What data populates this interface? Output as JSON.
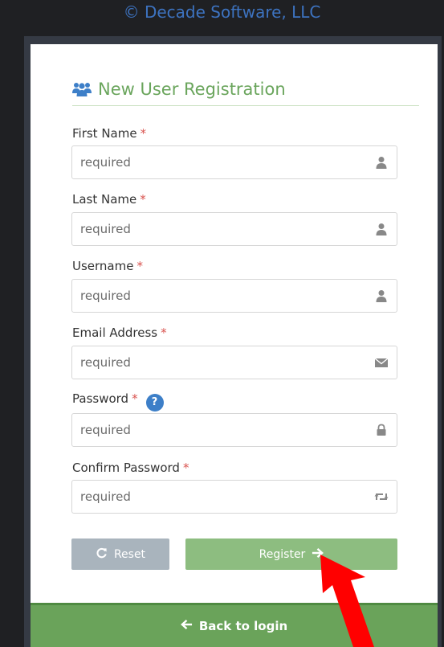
{
  "header": {
    "copyright": "© Decade Software, LLC"
  },
  "form": {
    "title": "New User Registration",
    "title_icon": "users-icon",
    "required_marker": "*",
    "fields": [
      {
        "label": "First Name",
        "placeholder": "required",
        "icon": "user-icon"
      },
      {
        "label": "Last Name",
        "placeholder": "required",
        "icon": "user-icon"
      },
      {
        "label": "Username",
        "placeholder": "required",
        "icon": "user-icon"
      },
      {
        "label": "Email Address",
        "placeholder": "required",
        "icon": "envelope-icon"
      },
      {
        "label": "Password",
        "placeholder": "required",
        "icon": "lock-icon",
        "help": "?"
      },
      {
        "label": "Confirm Password",
        "placeholder": "required",
        "icon": "retweet-icon"
      }
    ]
  },
  "actions": {
    "reset_label": "Reset",
    "reset_icon": "refresh-icon",
    "register_label": "Register",
    "register_icon": "arrow-right-icon"
  },
  "footer": {
    "back_label": "Back to login",
    "back_icon": "arrow-left-icon"
  },
  "annotation": {
    "type": "red-arrow",
    "points_to": "register-button",
    "color": "#ff0000"
  },
  "colors": {
    "title_green": "#6aa55c",
    "register_green": "#8dbd80",
    "back_green": "#6aa35a",
    "reset_gray": "#a9b4bd",
    "required_red": "#d9534f",
    "help_blue": "#3d7fc8",
    "copyright_blue": "#3d73c0"
  }
}
